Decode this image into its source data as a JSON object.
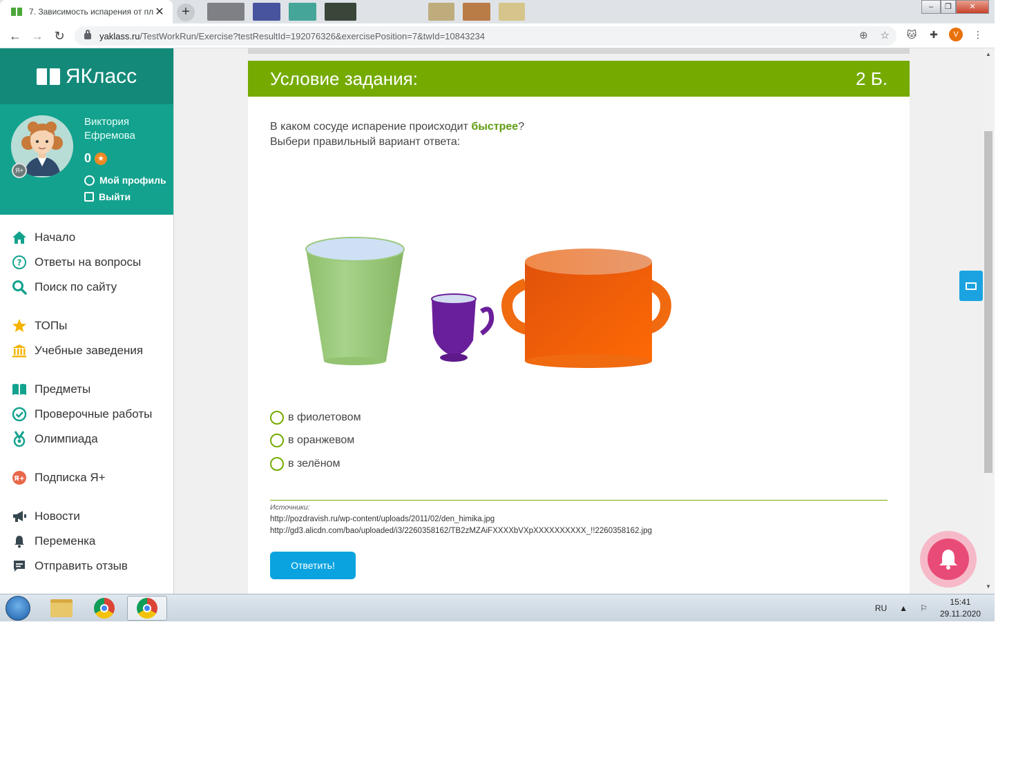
{
  "browser": {
    "tab_title": "7. Зависимость испарения от пл",
    "tab_close": "✕",
    "new_tab": "+",
    "url_host": "yaklass.ru",
    "url_path": "/TestWorkRun/Exercise?testResultId=192076326&exercisePosition=7&twId=10843234",
    "profile_initial": "V",
    "window_controls": [
      "–",
      "❐",
      "✕"
    ]
  },
  "sidebar": {
    "logo": "ЯКласс",
    "user_name_first": "Виктория",
    "user_name_last": "Ефремова",
    "points": "0",
    "badge": "Я+",
    "profile_link": "Мой профиль",
    "logout_link": "Выйти",
    "menu": [
      {
        "label": "Начало",
        "icon": "home-icon",
        "color": "#13a28e"
      },
      {
        "label": "Ответы на вопросы",
        "icon": "question-circle-icon",
        "color": "#13a28e"
      },
      {
        "label": "Поиск по сайту",
        "icon": "search-icon",
        "color": "#13a28e"
      },
      {
        "label": "ТОПы",
        "icon": "star-icon",
        "color": "#f5b400"
      },
      {
        "label": "Учебные заведения",
        "icon": "school-icon",
        "color": "#f5b400"
      },
      {
        "label": "Предметы",
        "icon": "book-icon",
        "color": "#13a28e"
      },
      {
        "label": "Проверочные работы",
        "icon": "check-circle-icon",
        "color": "#13a28e"
      },
      {
        "label": "Олимпиада",
        "icon": "medal-icon",
        "color": "#13a28e"
      },
      {
        "label": "Подписка Я+",
        "icon": "subscription-icon",
        "color": "#e8684a"
      },
      {
        "label": "Новости",
        "icon": "megaphone-icon",
        "color": "#37474f"
      },
      {
        "label": "Переменка",
        "icon": "bell-icon",
        "color": "#37474f"
      },
      {
        "label": "Отправить отзыв",
        "icon": "feedback-icon",
        "color": "#37474f"
      }
    ]
  },
  "task": {
    "header": "Условие задания:",
    "points": "2 Б.",
    "question_before": "В каком сосуде испарение происходит ",
    "question_highlight": "быстрее",
    "question_after": "?",
    "instruction": "Выбери правильный вариант ответа:",
    "options": [
      "в фиолетовом",
      "в оранжевом",
      "в зелёном"
    ],
    "sources_label": "Источники:",
    "sources": [
      "http://pozdravish.ru/wp-content/uploads/2011/02/den_himika.jpg",
      "http://gd3.alicdn.com/bao/uploaded/i3/2260358162/TB2zMZAiFXXXXbVXpXXXXXXXXXX_!!2260358162.jpg"
    ],
    "submit_label": "Ответить!"
  },
  "taskbar": {
    "lang": "RU",
    "time": "15:41",
    "date": "29.11.2020"
  },
  "colors": {
    "accent_green": "#75ab00",
    "teal": "#13a28e",
    "button_blue": "#0aa3e0",
    "vessel_green": "#9ccb7c",
    "vessel_purple": "#6a1f9a",
    "vessel_orange": "#f06a10"
  }
}
